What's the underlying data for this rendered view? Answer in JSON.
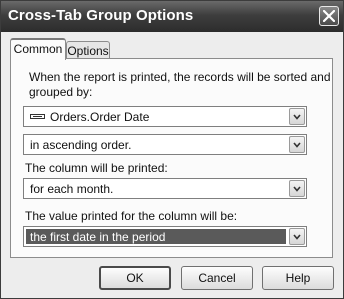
{
  "window": {
    "title": "Cross-Tab Group Options",
    "close_icon": "close-icon"
  },
  "tabs": [
    {
      "label": "Common",
      "active": true
    },
    {
      "label": "Options",
      "active": false
    }
  ],
  "common": {
    "sort_prompt_line1": "When the report is printed, the records will be sorted and",
    "sort_prompt_line2": "grouped by:",
    "group_field": {
      "value": "Orders.Order Date",
      "icon": "database-field-icon"
    },
    "sort_order": {
      "value": "in ascending order."
    },
    "column_prompt": "The column will be printed:",
    "column_interval": {
      "value": "for each month."
    },
    "value_prompt": "The value printed for the column will be:",
    "printed_value": {
      "value": "the first date in the period"
    }
  },
  "buttons": {
    "ok": "OK",
    "cancel": "Cancel",
    "help": "Help"
  }
}
